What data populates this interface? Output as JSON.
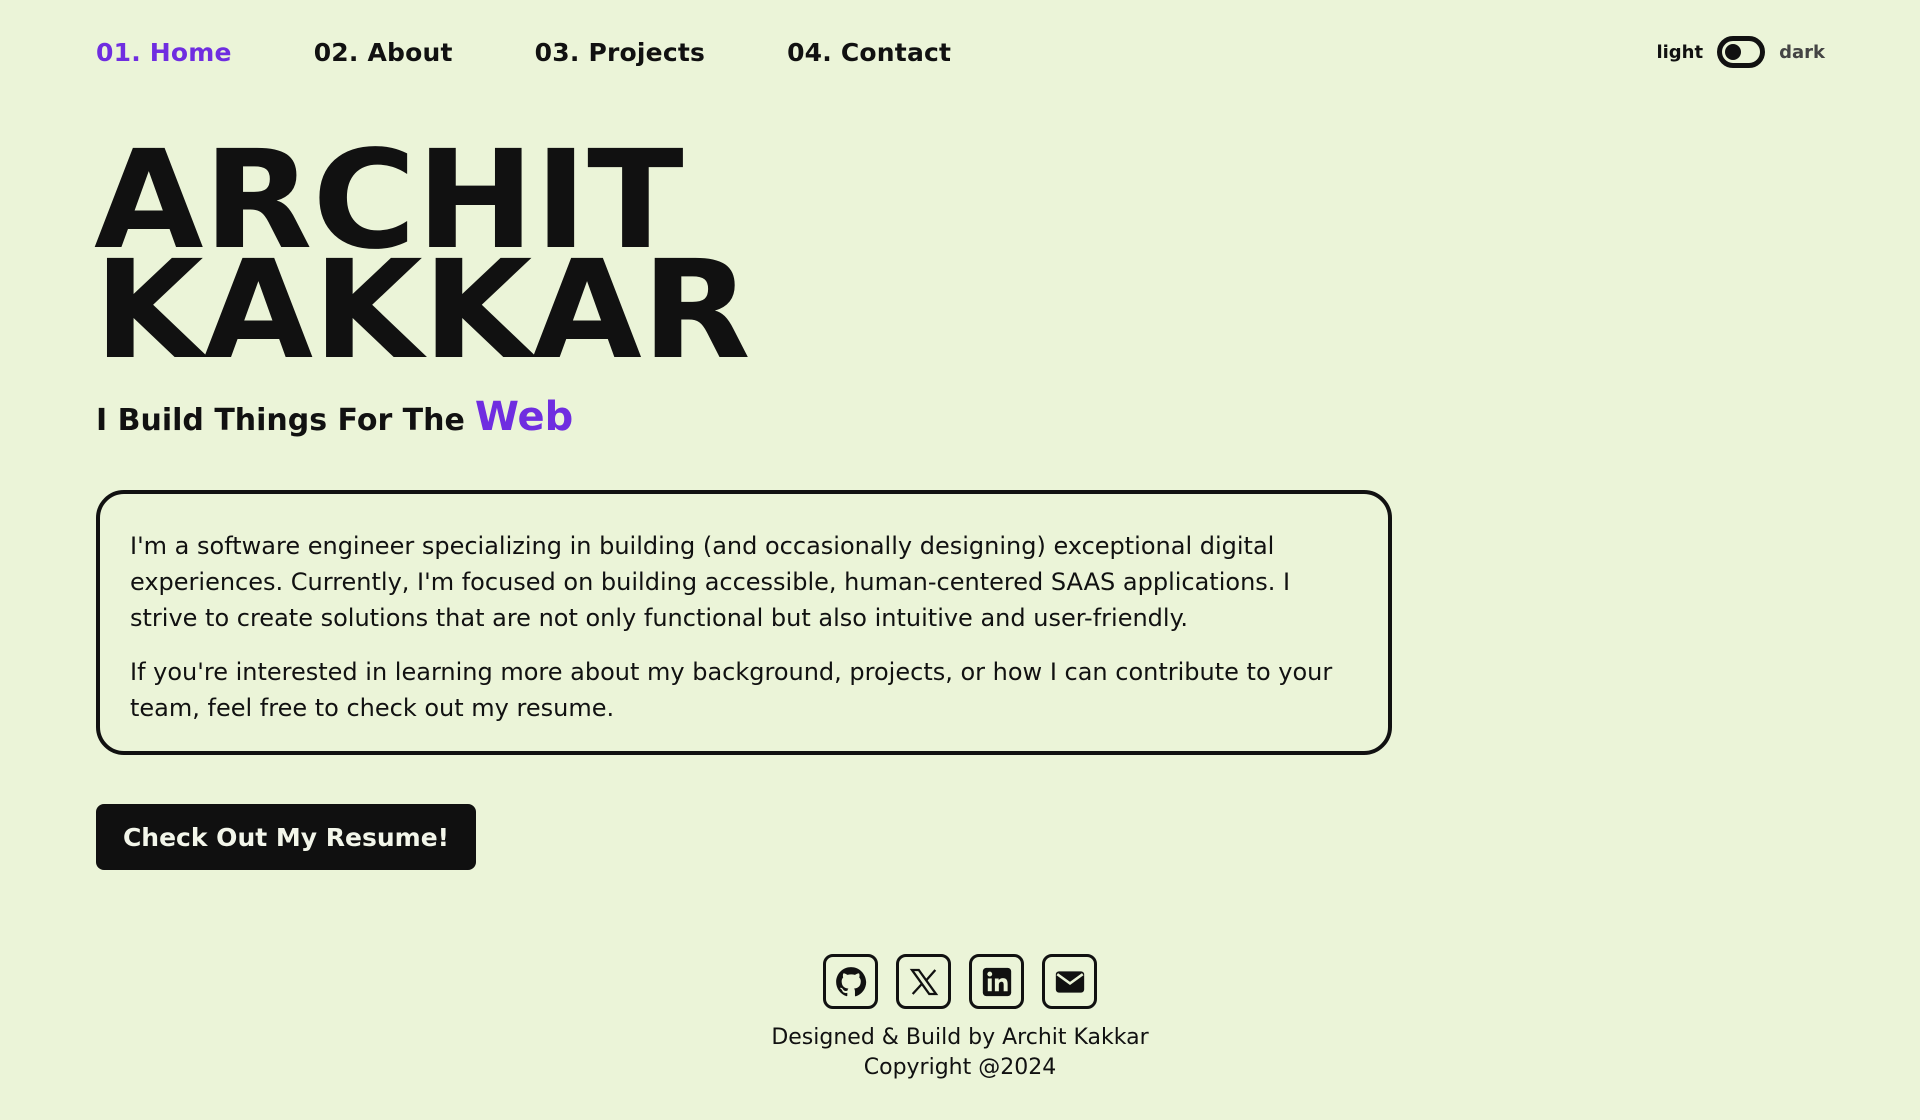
{
  "nav": {
    "items": [
      {
        "label": "01. Home",
        "active": true
      },
      {
        "label": "02. About",
        "active": false
      },
      {
        "label": "03. Projects",
        "active": false
      },
      {
        "label": "04. Contact",
        "active": false
      }
    ]
  },
  "theme": {
    "light_label": "light",
    "dark_label": "dark",
    "mode": "light"
  },
  "hero": {
    "first_name": "ARCHIT",
    "last_name": "KAKKAR",
    "tagline_prefix": "I Build Things For The",
    "tagline_accent": "Web"
  },
  "bio": {
    "paragraphs": [
      "I'm a software engineer specializing in building (and occasionally designing) exceptional digital experiences. Currently, I'm focused on building accessible, human-centered SAAS applications. I strive to create solutions that are not only functional but also intuitive and user-friendly.",
      "If you're interested in learning more about my background, projects, or how I can contribute to your team, feel free to check out my resume."
    ]
  },
  "cta": {
    "resume_label": "Check Out My Resume!"
  },
  "footer": {
    "socials": [
      "github-icon",
      "x-icon",
      "linkedin-icon",
      "mail-icon"
    ],
    "credit": "Designed & Build by Archit Kakkar",
    "copyright": "Copyright @2024"
  },
  "colors": {
    "background": "#ebf4d8",
    "accent": "#6f2de0",
    "ink": "#101010"
  }
}
